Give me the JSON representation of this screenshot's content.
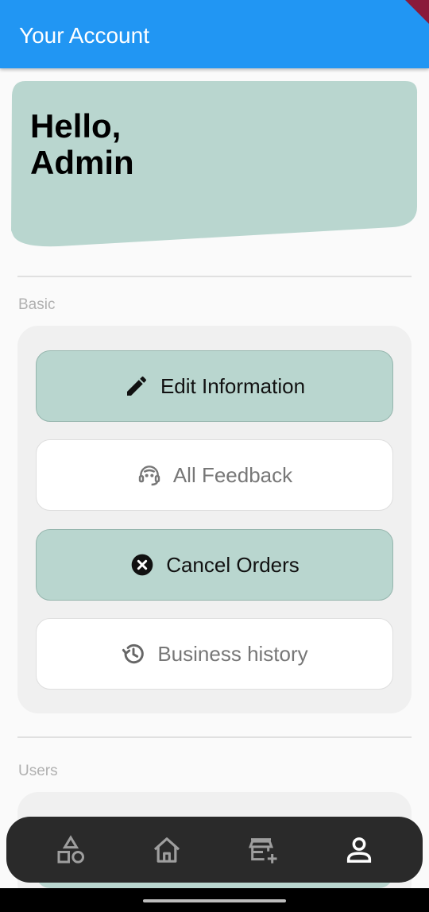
{
  "app_bar": {
    "title": "Your Account"
  },
  "greeting": {
    "line1": "Hello,",
    "line2": "Admin"
  },
  "sections": {
    "basic": {
      "label": "Basic",
      "buttons": [
        {
          "label": "Edit Information",
          "icon": "pencil-icon",
          "style": "filled"
        },
        {
          "label": "All Feedback",
          "icon": "support-agent-icon",
          "style": "outline"
        },
        {
          "label": "Cancel Orders",
          "icon": "cancel-circle-icon",
          "style": "filled"
        },
        {
          "label": "Business history",
          "icon": "history-icon",
          "style": "outline"
        }
      ]
    },
    "users": {
      "label": "Users"
    }
  },
  "bottom_nav": {
    "items": [
      {
        "icon": "category-shapes-icon",
        "active": false
      },
      {
        "icon": "home-icon",
        "active": false
      },
      {
        "icon": "add-store-icon",
        "active": false
      },
      {
        "icon": "person-icon",
        "active": true
      }
    ]
  },
  "colors": {
    "app_bar": "#2196f3",
    "accent_fill": "#b9d6cf",
    "nav_background": "#2a2a2a"
  }
}
